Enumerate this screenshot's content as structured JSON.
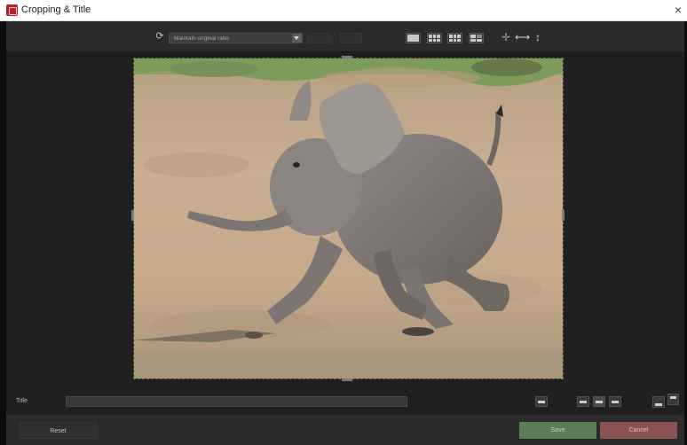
{
  "window": {
    "title": "Cropping & Title",
    "close_glyph": "×"
  },
  "toolbar": {
    "ratio_icon": "refresh-icon",
    "ratio_value": "Maintain original ratio",
    "width_value": "",
    "separator": ":",
    "height_value": "",
    "grid_icons": [
      "grid-none-icon",
      "grid-thirds-icon",
      "grid-thirds-alt-icon",
      "grid-quarters-icon"
    ],
    "tool_icons": [
      "crosshair-icon",
      "fit-horizontal-icon",
      "fit-vertical-icon"
    ]
  },
  "image": {
    "subject": "baby elephant running",
    "sky_colors": [
      "#7f9b5a",
      "#d6c0a2"
    ]
  },
  "title_row": {
    "label": "Title",
    "value": "",
    "align_icons": [
      "text-bar-icon",
      "align-left-icon",
      "align-center-icon",
      "align-right-icon",
      "position-bottom-icon",
      "position-top-icon"
    ]
  },
  "footer": {
    "reset_label": "Reset",
    "save_label": "Save",
    "cancel_label": "Cancel"
  },
  "colors": {
    "save": "#5a7e55",
    "cancel": "#8a5353",
    "background": "#202020",
    "accent": "#b8202a"
  }
}
